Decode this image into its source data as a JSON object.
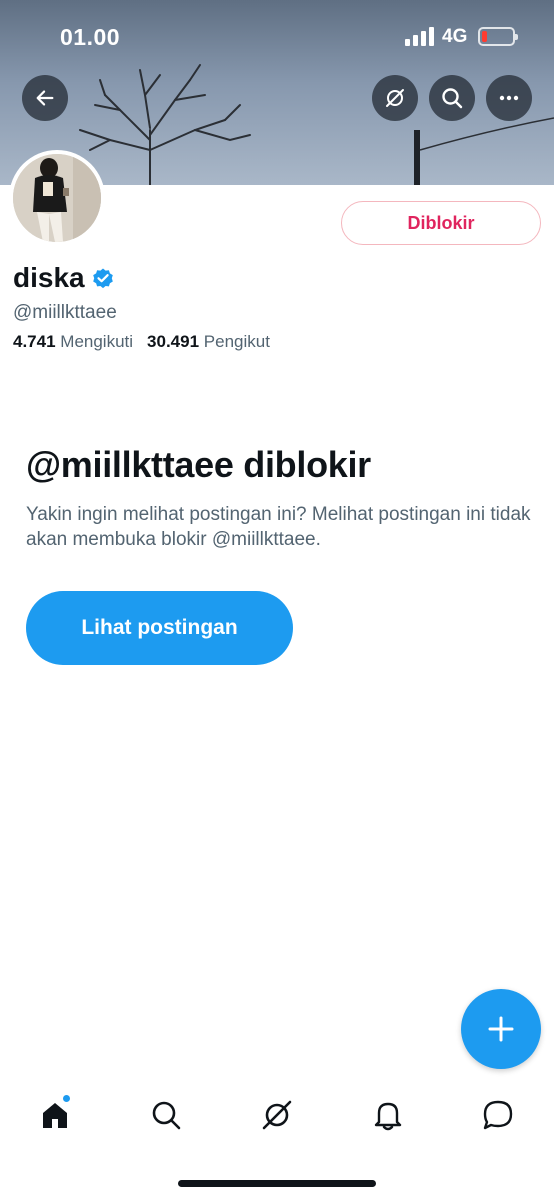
{
  "status_bar": {
    "time": "01.00",
    "network": "4G",
    "battery_level": 0.15,
    "battery_color": "#ff3b30"
  },
  "header": {
    "back_icon": "arrow-left-icon",
    "grok_icon": "grok-icon",
    "search_icon": "search-icon",
    "more_icon": "more-horizontal-icon"
  },
  "profile": {
    "display_name": "diska",
    "verified": true,
    "handle": "@miillkttaee",
    "following_count": "4.741",
    "following_label": "Mengikuti",
    "followers_count": "30.491",
    "followers_label": "Pengikut",
    "blocked_button_label": "Diblokir"
  },
  "blocked_notice": {
    "title": "@miillkttaee diblokir",
    "description": "Yakin ingin melihat postingan ini? Melihat postingan ini tidak akan membuka blokir @miillkttaee.",
    "view_button_label": "Lihat postingan"
  },
  "fab": {
    "icon": "plus-icon"
  },
  "bottom_nav": {
    "items": [
      {
        "name": "home",
        "icon": "home-icon",
        "active": true,
        "has_badge": true
      },
      {
        "name": "search",
        "icon": "search-icon"
      },
      {
        "name": "grok",
        "icon": "grok-icon"
      },
      {
        "name": "notifications",
        "icon": "bell-icon"
      },
      {
        "name": "messages",
        "icon": "message-icon"
      }
    ]
  },
  "colors": {
    "accent": "#1d9bf0",
    "blocked": "#e0245e",
    "text_primary": "#0f1419",
    "text_secondary": "#536471"
  }
}
